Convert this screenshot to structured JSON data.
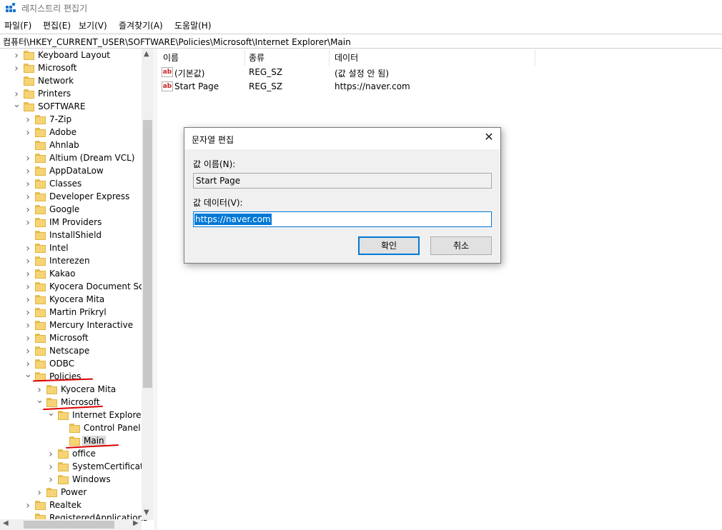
{
  "window": {
    "title": "레지스트리 편집기",
    "app_icon": "registry-icon"
  },
  "menu": [
    "파일(F)",
    "편집(E)",
    "보기(V)",
    "즐겨찾기(A)",
    "도움말(H)"
  ],
  "address": "컴퓨터\\HKEY_CURRENT_USER\\SOFTWARE\\Policies\\Microsoft\\Internet Explorer\\Main",
  "tree": [
    {
      "label": "Keyboard Layout",
      "depth": 1,
      "expander": ">"
    },
    {
      "label": "Microsoft",
      "depth": 1,
      "expander": ">"
    },
    {
      "label": "Network",
      "depth": 1,
      "expander": ""
    },
    {
      "label": "Printers",
      "depth": 1,
      "expander": ">"
    },
    {
      "label": "SOFTWARE",
      "depth": 1,
      "expander": "v"
    },
    {
      "label": "7-Zip",
      "depth": 2,
      "expander": ">"
    },
    {
      "label": "Adobe",
      "depth": 2,
      "expander": ">"
    },
    {
      "label": "Ahnlab",
      "depth": 2,
      "expander": ""
    },
    {
      "label": "Altium (Dream VCL)",
      "depth": 2,
      "expander": ">"
    },
    {
      "label": "AppDataLow",
      "depth": 2,
      "expander": ">"
    },
    {
      "label": "Classes",
      "depth": 2,
      "expander": ">"
    },
    {
      "label": "Developer Express",
      "depth": 2,
      "expander": ">"
    },
    {
      "label": "Google",
      "depth": 2,
      "expander": ">"
    },
    {
      "label": "IM Providers",
      "depth": 2,
      "expander": ">"
    },
    {
      "label": "InstallShield",
      "depth": 2,
      "expander": ""
    },
    {
      "label": "Intel",
      "depth": 2,
      "expander": ">"
    },
    {
      "label": "Interezen",
      "depth": 2,
      "expander": ">"
    },
    {
      "label": "Kakao",
      "depth": 2,
      "expander": ">"
    },
    {
      "label": "Kyocera Document Solu",
      "depth": 2,
      "expander": ">"
    },
    {
      "label": "Kyocera Mita",
      "depth": 2,
      "expander": ">"
    },
    {
      "label": "Martin Prikryl",
      "depth": 2,
      "expander": ">"
    },
    {
      "label": "Mercury Interactive",
      "depth": 2,
      "expander": ">"
    },
    {
      "label": "Microsoft",
      "depth": 2,
      "expander": ">"
    },
    {
      "label": "Netscape",
      "depth": 2,
      "expander": ">"
    },
    {
      "label": "ODBC",
      "depth": 2,
      "expander": ">"
    },
    {
      "label": "Policies",
      "depth": 2,
      "expander": "v"
    },
    {
      "label": "Kyocera Mita",
      "depth": 3,
      "expander": ">"
    },
    {
      "label": "Microsoft",
      "depth": 3,
      "expander": "v"
    },
    {
      "label": "Internet Explorer",
      "depth": 4,
      "expander": "v"
    },
    {
      "label": "Control Panel",
      "depth": 5,
      "expander": ""
    },
    {
      "label": "Main",
      "depth": 5,
      "expander": "",
      "selected": true
    },
    {
      "label": "office",
      "depth": 4,
      "expander": ">"
    },
    {
      "label": "SystemCertificates",
      "depth": 4,
      "expander": ">"
    },
    {
      "label": "Windows",
      "depth": 4,
      "expander": ">"
    },
    {
      "label": "Power",
      "depth": 3,
      "expander": ">"
    },
    {
      "label": "Realtek",
      "depth": 2,
      "expander": ">"
    },
    {
      "label": "RegisteredApplications",
      "depth": 2,
      "expander": ""
    }
  ],
  "list": {
    "columns": [
      "이름",
      "종류",
      "데이터"
    ],
    "rows": [
      {
        "icon": "string-value-icon",
        "icon_text": "ab",
        "name": "(기본값)",
        "type": "REG_SZ",
        "data": "(값 설정 안 됨)"
      },
      {
        "icon": "string-value-icon",
        "icon_text": "ab",
        "name": "Start Page",
        "type": "REG_SZ",
        "data": "https://naver.com"
      }
    ]
  },
  "dialog": {
    "title": "문자열 편집",
    "name_label": "값 이름(N):",
    "name_value": "Start Page",
    "data_label": "값 데이터(V):",
    "data_value": "https://naver.com",
    "ok": "확인",
    "cancel": "취소"
  },
  "colors": {
    "selection": "#0078d7",
    "annotation": "#dd0000",
    "folder": "#f6d475"
  }
}
